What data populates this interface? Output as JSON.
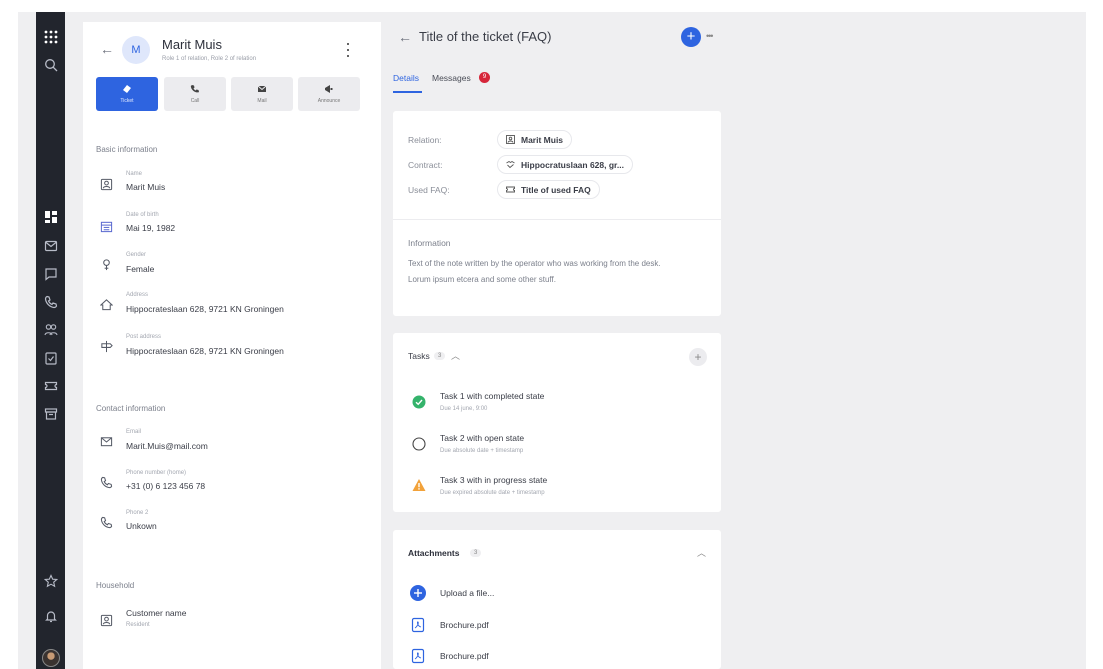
{
  "contact": {
    "avatar_initial": "M",
    "name": "Marit Muis",
    "roles": "Role 1 of relation, Role 2 of relation"
  },
  "actions": [
    {
      "label": "Ticket",
      "icon": "ticket-icon"
    },
    {
      "label": "Call",
      "icon": "phone-icon"
    },
    {
      "label": "Mail",
      "icon": "mail-icon"
    },
    {
      "label": "Announce",
      "icon": "megaphone-icon"
    }
  ],
  "basic": {
    "title": "Basic information",
    "name_label": "Name",
    "name_value": "Marit Muis",
    "dob_label": "Date of birth",
    "dob_value": "Mai 19, 1982",
    "gender_label": "Gender",
    "gender_value": "Female",
    "address_label": "Address",
    "address_value": "Hippocrateslaan 628, 9721 KN Groningen",
    "post_label": "Post address",
    "post_value": "Hippocrateslaan 628, 9721 KN Groningen"
  },
  "contact_info": {
    "title": "Contact information",
    "email_label": "Email",
    "email_value": "Marit.Muis@mail.com",
    "phone_label": "Phone number (home)",
    "phone_value": "+31 (0) 6 123 456 78",
    "phone2_label": "Phone 2",
    "phone2_value": "Unkown"
  },
  "household": {
    "title": "Household",
    "customer_name": "Customer name",
    "customer_role": "Resident"
  },
  "ticket": {
    "title": "Title of the ticket (FAQ)",
    "add_symbol": "+",
    "more_symbol": "•••",
    "tabs": {
      "details": "Details",
      "messages": "Messages",
      "messages_badge": "9"
    },
    "relation_label": "Relation:",
    "relation_value": "Marit Muis",
    "contract_label": "Contract:",
    "contract_value": "Hippocratuslaan 628, gr...",
    "faq_label": "Used FAQ:",
    "faq_value": "Title of used FAQ",
    "info_title": "Information",
    "info_text": "Text of the note written by the operator who was working from the desk. Lorum ipsum etcera and some other stuff."
  },
  "tasks": {
    "title": "Tasks",
    "count": "3",
    "items": [
      {
        "name": "Task 1 with completed state",
        "due": "Due 14 june, 9:00",
        "state": "completed"
      },
      {
        "name": "Task 2 with open state",
        "due": "Due absolute date + timestamp",
        "state": "open"
      },
      {
        "name": "Task 3 with in progress state",
        "due": "Due expired absolute date + timestamp",
        "state": "warning"
      }
    ]
  },
  "attachments": {
    "title": "Attachments",
    "count": "3",
    "upload": "Upload a file...",
    "files": [
      "Brochure.pdf",
      "Brochure.pdf"
    ]
  },
  "colors": {
    "accent": "#2e64e0",
    "rail": "#22252d",
    "success": "#34b36b",
    "warning": "#f2a23a",
    "badge": "#d6263a"
  }
}
